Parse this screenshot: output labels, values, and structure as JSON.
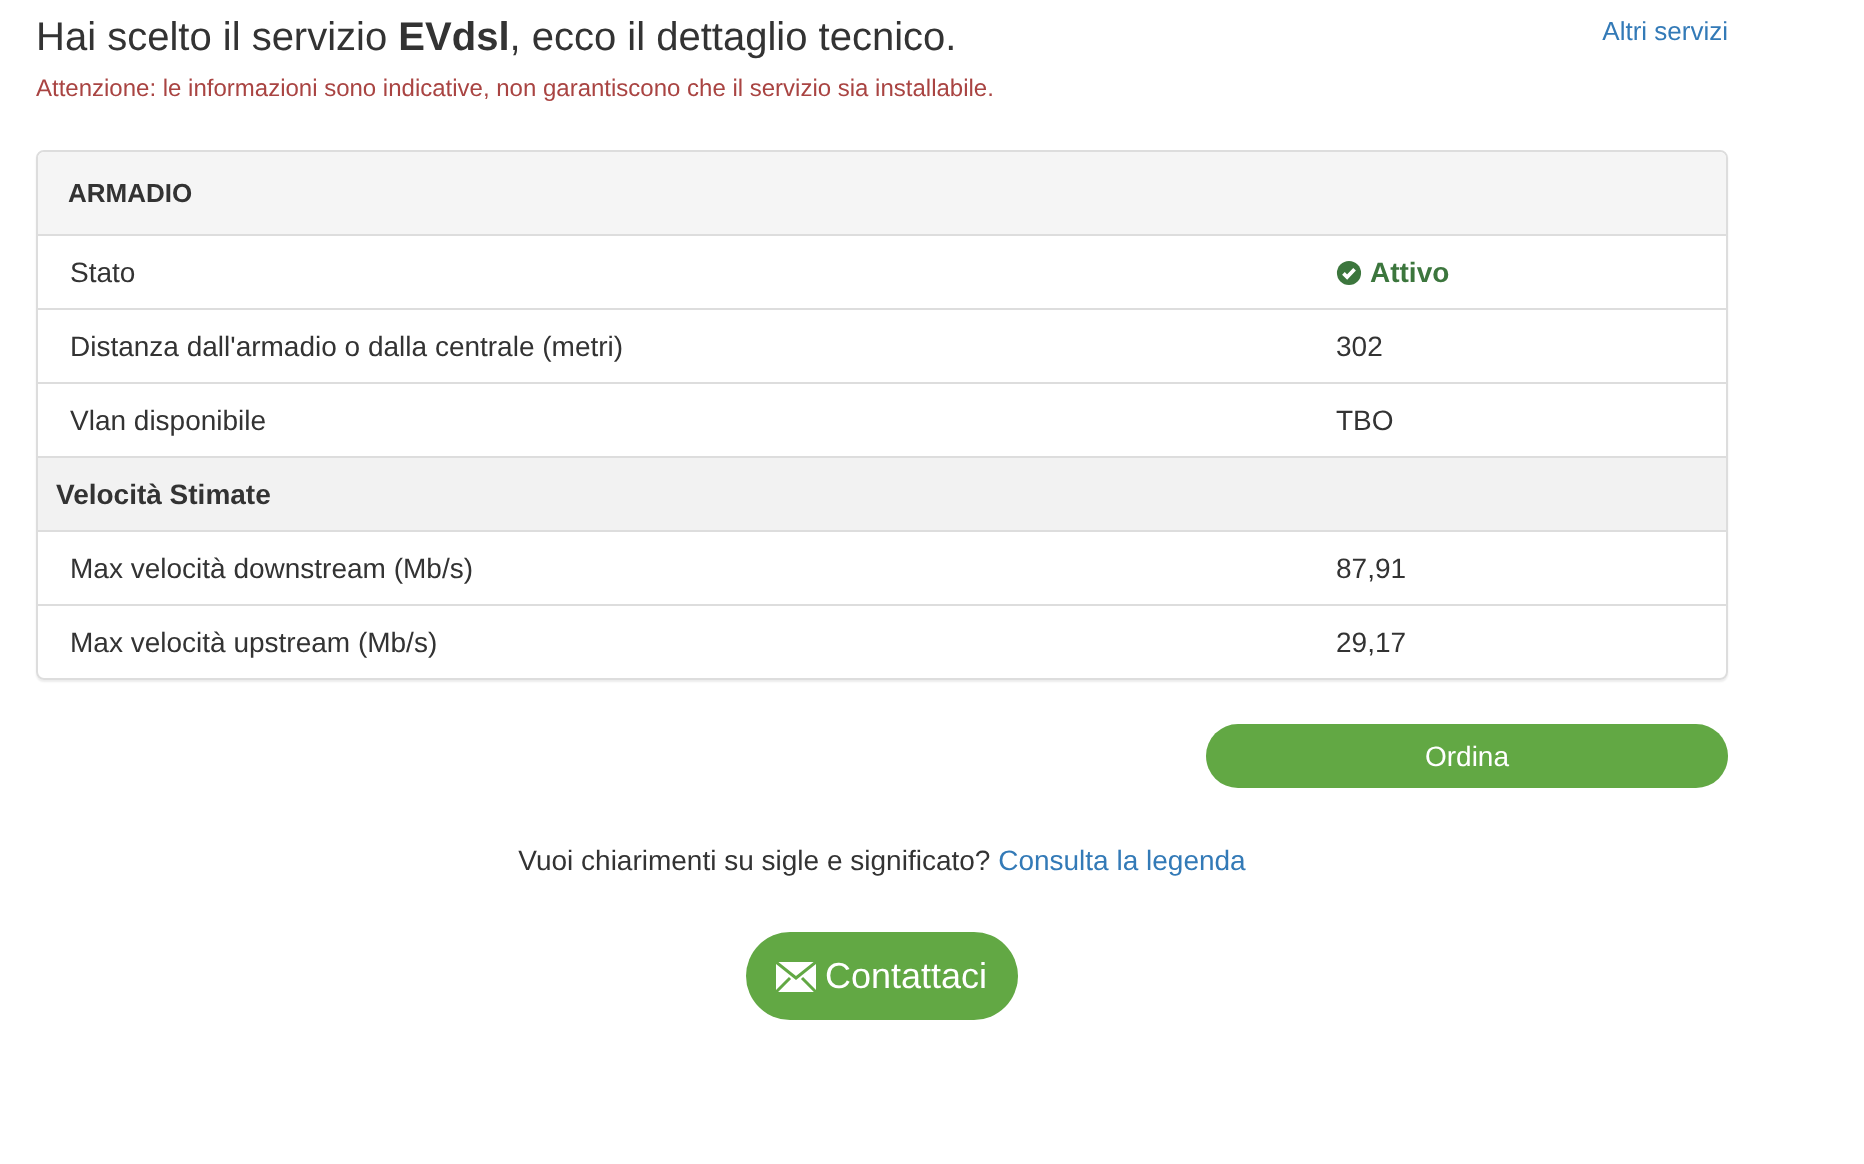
{
  "title": "Hai scelto il servizio **EVdsl**, ecco il dettaglio tecnico.",
  "other_services_link": "Altri servizi",
  "warning": "Attenzione: le informazioni sono indicative, non garantiscono che il servizio sia installabile.",
  "panel": {
    "heading": "ARMADIO",
    "rows": [
      {
        "kind": "status",
        "label": "Stato",
        "value": "Attivo"
      },
      {
        "kind": "data",
        "label": "Distanza dall'armadio o dalla centrale (metri)",
        "value": "302"
      },
      {
        "kind": "data",
        "label": "Vlan disponibile",
        "value": "TBO"
      },
      {
        "kind": "section",
        "label": "Velocità Stimate"
      },
      {
        "kind": "data",
        "label": "Max velocità downstream (Mb/s)",
        "value": "87,91"
      },
      {
        "kind": "data",
        "label": "Max velocità upstream (Mb/s)",
        "value": "29,17"
      }
    ]
  },
  "order_button": "Ordina",
  "legend_prompt": "Vuoi chiarimenti su sigle e significato?",
  "legend_link": "Consulta la legenda",
  "contact_button": "Contattaci"
}
